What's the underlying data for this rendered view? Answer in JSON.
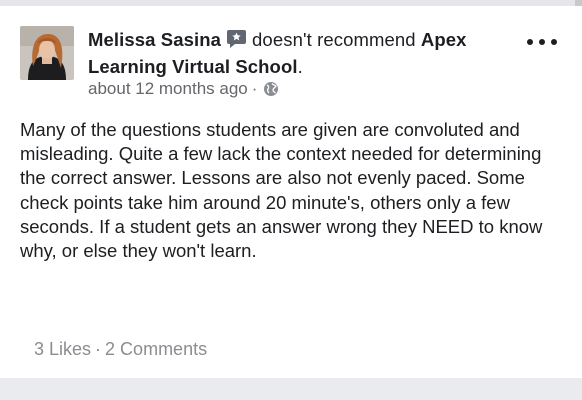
{
  "post": {
    "author": "Melissa Sasina",
    "action": "doesn't recommend",
    "page_name": "Apex Learning Virtual School",
    "page_suffix": ".",
    "time": "about 12 months ago",
    "meta_separator": "·",
    "privacy_icon": "globe-icon",
    "recommend_badge_icon": "review-badge-icon",
    "more_icon": "more-options-icon",
    "review_text": "Many of the questions students are given are convoluted and misleading. Quite a few lack the context needed for determining the correct answer. Lessons are also not evenly paced. Some check points take him around 20 minute's, others only a few seconds. If a student gets an answer wrong they NEED to know why, or else they won't learn."
  },
  "stats": {
    "likes": "3 Likes",
    "separator": "·",
    "comments": "2 Comments"
  },
  "colors": {
    "text": "#1c1e21",
    "meta": "#65676b",
    "stats": "#8a8d91",
    "badge": "#606770",
    "background": "#ffffff",
    "divider": "#e9ebee"
  }
}
